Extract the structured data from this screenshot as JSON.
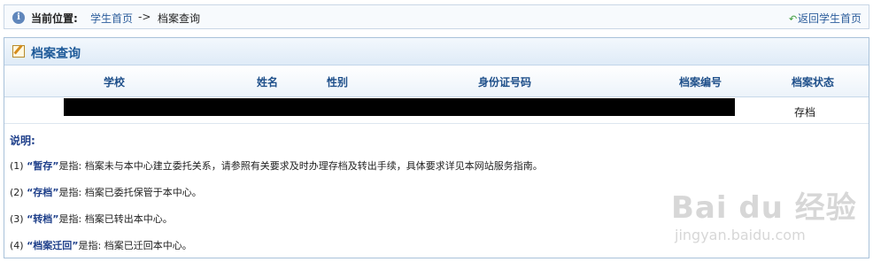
{
  "breadcrumb": {
    "location_label": "当前位置:",
    "home_link": "学生首页",
    "separator": "->",
    "current_page": "档案查询",
    "back_link": "返回学生首页"
  },
  "panel": {
    "title": "档案查询"
  },
  "table": {
    "headers": [
      "学校",
      "姓名",
      "性别",
      "身份证号码",
      "档案编号",
      "档案状态"
    ],
    "rows": [
      {
        "status": "存档"
      }
    ]
  },
  "notes": {
    "title": "说明:",
    "items": [
      {
        "prefix": "(1) ",
        "term": "“暂存”",
        "text": "是指: 档案未与本中心建立委托关系，请参照有关要求及时办理存档及转出手续，具体要求详见本网站服务指南。"
      },
      {
        "prefix": "(2) ",
        "term": "“存档”",
        "text": "是指: 档案已委托保管于本中心。"
      },
      {
        "prefix": "(3) ",
        "term": "“转档”",
        "text": "是指: 档案已转出本中心。"
      },
      {
        "prefix": "(4) ",
        "term": "“档案迁回”",
        "text": "是指: 档案已迁回本中心。"
      }
    ]
  },
  "watermark": {
    "logo": "Bai du 经验",
    "url": "jingyan.baidu.com"
  },
  "icons": {
    "info": "info-icon",
    "back": "back-arrow-icon",
    "panel": "edit-note-icon"
  }
}
